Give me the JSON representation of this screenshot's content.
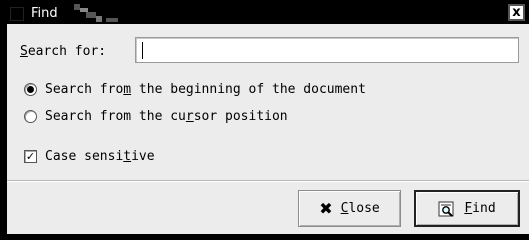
{
  "window": {
    "title": "Find",
    "close_glyph": "x",
    "close_icon": "close-icon"
  },
  "search": {
    "label_pre": "",
    "label_mn": "S",
    "label_post": "earch for:",
    "value": ""
  },
  "options": {
    "from_beginning": {
      "pre": "Search fro",
      "mn": "m",
      "post": " the beginning of the document",
      "selected": true
    },
    "from_cursor": {
      "pre": "Search from the cu",
      "mn": "r",
      "post": "sor position",
      "selected": false
    },
    "case_sensitive": {
      "pre": "Case sensi",
      "mn": "t",
      "post": "ive",
      "checked": true,
      "check_glyph": "✓"
    }
  },
  "buttons": {
    "close": {
      "icon": "x-icon",
      "glyph": "✖",
      "mn": "C",
      "post": "lose"
    },
    "find": {
      "icon": "find-icon",
      "mn": "F",
      "post": "ind"
    }
  }
}
